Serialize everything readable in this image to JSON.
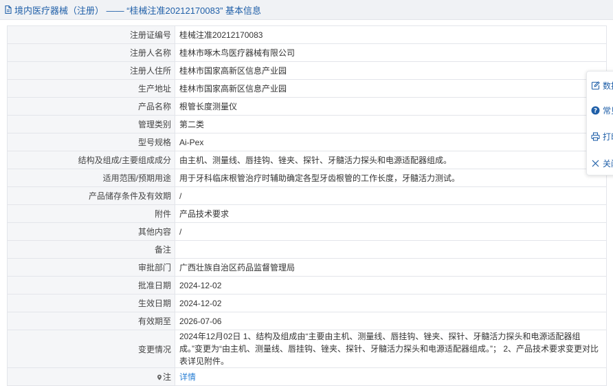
{
  "header": {
    "title": "境内医疗器械（注册） —— “桂械注准20212170083” 基本信息"
  },
  "rows": [
    {
      "label": "注册证编号",
      "value": "桂械注准20212170083"
    },
    {
      "label": "注册人名称",
      "value": "桂林市啄木鸟医疗器械有限公司"
    },
    {
      "label": "注册人住所",
      "value": "桂林市国家高新区信息产业园"
    },
    {
      "label": "生产地址",
      "value": "桂林市国家高新区信息产业园"
    },
    {
      "label": "产品名称",
      "value": "根管长度测量仪"
    },
    {
      "label": "管理类别",
      "value": "第二类"
    },
    {
      "label": "型号规格",
      "value": "Ai-Pex"
    },
    {
      "label": "结构及组成/主要组成成分",
      "value": "由主机、测量线、唇挂钩、锉夹、探针、牙髓活力探头和电源适配器组成。"
    },
    {
      "label": "适用范围/预期用途",
      "value": "用于牙科临床根管治疗时辅助确定各型牙齿根管的工作长度，牙髓活力测试。"
    },
    {
      "label": "产品储存条件及有效期",
      "value": "/"
    },
    {
      "label": "附件",
      "value": "产品技术要求"
    },
    {
      "label": "其他内容",
      "value": "/"
    },
    {
      "label": "备注",
      "value": ""
    },
    {
      "label": "审批部门",
      "value": "广西壮族自治区药品监督管理局"
    },
    {
      "label": "批准日期",
      "value": "2024-12-02"
    },
    {
      "label": "生效日期",
      "value": "2024-12-02"
    },
    {
      "label": "有效期至",
      "value": "2026-07-06"
    },
    {
      "label": "变更情况",
      "value": "2024年12月02日 1、结构及组成由“主要由主机、测量线、唇挂钩、锉夹、探针、牙髓活力探头和电源适配器组成。”变更为“由主机、测量线、唇挂钩、锉夹、探针、牙髓活力探头和电源适配器组成。”； 2、产品技术要求变更对比表详见附件。"
    }
  ],
  "note_row": {
    "label": "注",
    "link": "详情"
  },
  "side_panel": [
    {
      "label": "数据纠错",
      "icon": "edit-icon"
    },
    {
      "label": "常见问题",
      "icon": "question-icon"
    },
    {
      "label": "打印",
      "icon": "print-icon"
    },
    {
      "label": "关闭",
      "icon": "close-icon"
    }
  ],
  "colors": {
    "accent": "#1f5fa8",
    "link": "#2a7fd4",
    "label_bg": "#f5f6f8",
    "border": "#e3e5ea",
    "header_bg": "#f0f2f5"
  }
}
